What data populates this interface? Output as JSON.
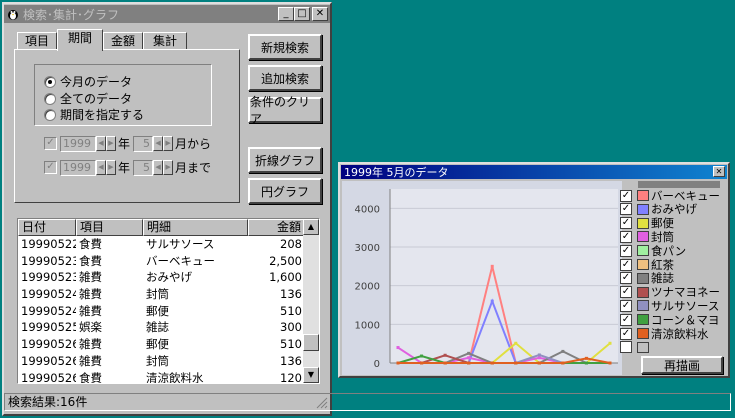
{
  "main_window": {
    "title": "検索･集計･グラフ",
    "tabs": [
      "項目",
      "期間",
      "金額",
      "集計"
    ],
    "selected_tab": "期間",
    "radios": [
      {
        "label": "今月のデータ",
        "checked": true
      },
      {
        "label": "全てのデータ",
        "checked": false
      },
      {
        "label": "期間を指定する",
        "checked": false
      }
    ],
    "range_from": {
      "year": "1999",
      "year_suffix": "年",
      "month": "5",
      "month_suffix": "月から"
    },
    "range_to": {
      "year": "1999",
      "year_suffix": "年",
      "month": "5",
      "month_suffix": "月まで"
    },
    "buttons": {
      "new_search": "新規検索",
      "add_search": "追加検索",
      "clear_conditions": "条件のクリア",
      "line_graph": "折線グラフ",
      "pie_graph": "円グラフ"
    },
    "table": {
      "headers": [
        "日付",
        "項目",
        "明細",
        "金額"
      ],
      "rows": [
        [
          "19990522",
          "食費",
          "サルサソース",
          "208"
        ],
        [
          "19990523",
          "食費",
          "バーベキュー",
          "2,500"
        ],
        [
          "19990523",
          "雑費",
          "おみやげ",
          "1,600"
        ],
        [
          "19990524",
          "雑費",
          "封筒",
          "136"
        ],
        [
          "19990524",
          "雑費",
          "郵便",
          "510"
        ],
        [
          "19990525",
          "娯楽",
          "雑誌",
          "300"
        ],
        [
          "19990526",
          "雑費",
          "郵便",
          "510"
        ],
        [
          "19990526",
          "雑費",
          "封筒",
          "136"
        ],
        [
          "19990526",
          "食費",
          "清涼飲料水",
          "120"
        ]
      ]
    },
    "status": "検索結果:16件"
  },
  "graph_window": {
    "title": "1999年 5月のデータ",
    "redraw_button": "再描画",
    "legend": [
      {
        "label": "バーベキュー",
        "color": "#ff8080",
        "checked": true
      },
      {
        "label": "おみやげ",
        "color": "#8080ff",
        "checked": true
      },
      {
        "label": "郵便",
        "color": "#e0e040",
        "checked": true
      },
      {
        "label": "封筒",
        "color": "#e060e0",
        "checked": true
      },
      {
        "label": "食パン",
        "color": "#a0f0a0",
        "checked": true
      },
      {
        "label": "紅茶",
        "color": "#f0c080",
        "checked": true
      },
      {
        "label": "雑誌",
        "color": "#808080",
        "checked": true
      },
      {
        "label": "ツナマヨネー",
        "color": "#b05050",
        "checked": true
      },
      {
        "label": "サルサソース",
        "color": "#9090c0",
        "checked": true
      },
      {
        "label": "コーン＆マヨ",
        "color": "#40a040",
        "checked": true
      },
      {
        "label": "清涼飲料水",
        "color": "#e06020",
        "checked": true
      },
      {
        "label": "",
        "color": "#c0c0c0",
        "checked": false
      }
    ]
  },
  "chart_data": {
    "type": "line",
    "title": "",
    "xlabel": "",
    "ylabel": "",
    "ylim": [
      0,
      4500
    ],
    "yticks": [
      "4000",
      "3000",
      "2000",
      "1000",
      "0"
    ],
    "x": [
      1,
      2,
      3,
      4,
      5,
      6,
      7,
      8,
      9,
      10
    ],
    "series": [
      {
        "name": "バーベキュー",
        "color": "#ff8080",
        "values": [
          0,
          0,
          0,
          0,
          2500,
          0,
          0,
          0,
          0,
          0
        ]
      },
      {
        "name": "おみやげ",
        "color": "#8080ff",
        "values": [
          0,
          0,
          0,
          0,
          1600,
          0,
          0,
          0,
          0,
          0
        ]
      },
      {
        "name": "郵便",
        "color": "#e0e040",
        "values": [
          0,
          0,
          0,
          0,
          0,
          510,
          0,
          0,
          0,
          510
        ]
      },
      {
        "name": "封筒",
        "color": "#e060e0",
        "values": [
          400,
          0,
          0,
          136,
          0,
          0,
          136,
          0,
          0,
          0
        ]
      },
      {
        "name": "雑誌",
        "color": "#808080",
        "values": [
          0,
          0,
          0,
          250,
          0,
          0,
          0,
          300,
          0,
          0
        ]
      },
      {
        "name": "ツナマヨネー",
        "color": "#b05050",
        "values": [
          0,
          0,
          200,
          0,
          0,
          0,
          0,
          0,
          0,
          0
        ]
      },
      {
        "name": "サルサソース",
        "color": "#9090c0",
        "values": [
          0,
          0,
          0,
          0,
          0,
          0,
          208,
          0,
          0,
          0
        ]
      },
      {
        "name": "コーン＆マヨ",
        "color": "#40a040",
        "values": [
          0,
          180,
          0,
          0,
          0,
          0,
          0,
          0,
          0,
          0
        ]
      },
      {
        "name": "清涼飲料水",
        "color": "#e06020",
        "values": [
          0,
          0,
          0,
          0,
          0,
          0,
          0,
          0,
          120,
          0
        ]
      }
    ]
  }
}
